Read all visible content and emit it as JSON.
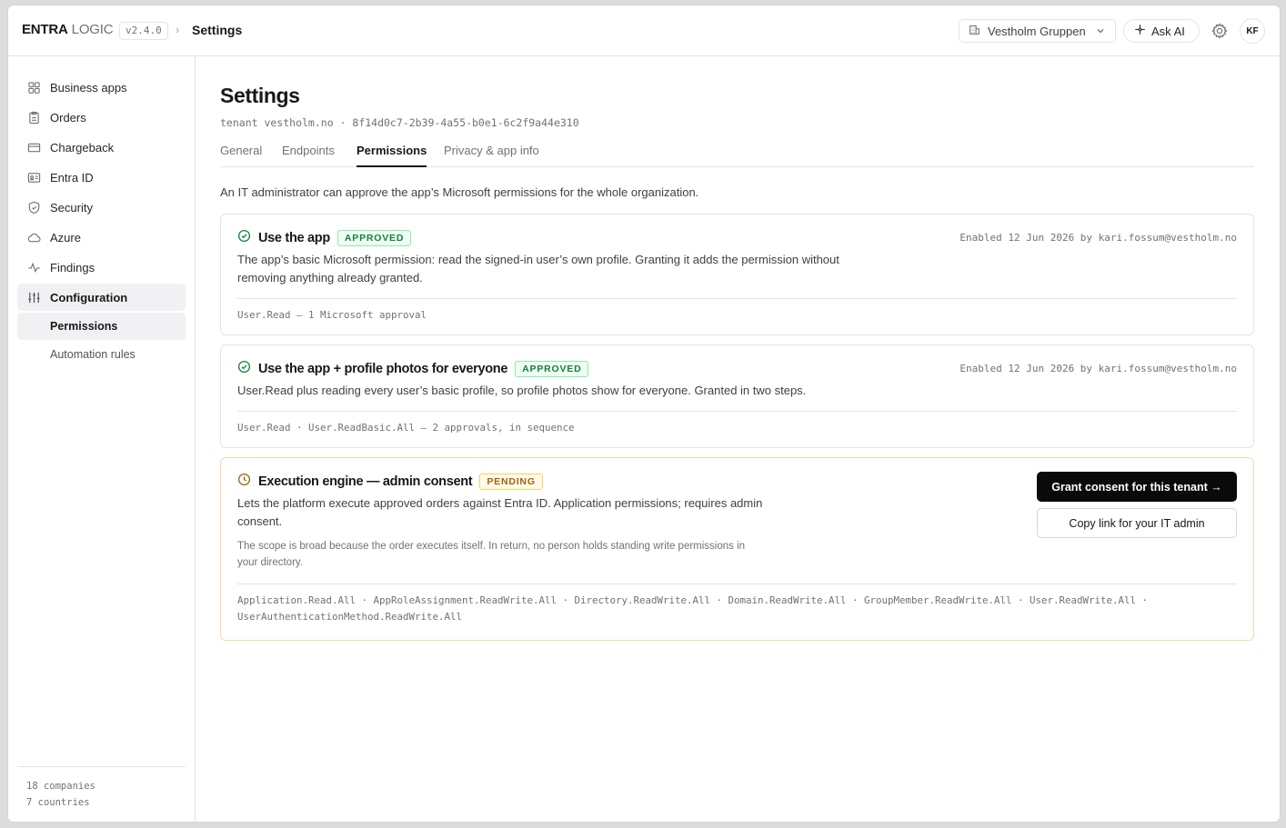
{
  "header": {
    "brand_strong": "ENTRA",
    "brand_light": "LOGIC",
    "version": "v2.4.0",
    "breadcrumb_sep": "›",
    "breadcrumb": "Settings",
    "org_selector": "Vestholm Gruppen",
    "ask_ai": "Ask AI",
    "avatar_initials": "KF"
  },
  "sidebar": {
    "items": [
      {
        "label": "Business apps",
        "icon": "grid-icon"
      },
      {
        "label": "Orders",
        "icon": "clipboard-icon"
      },
      {
        "label": "Chargeback",
        "icon": "credit-card-icon"
      },
      {
        "label": "Entra ID",
        "icon": "id-card-icon"
      },
      {
        "label": "Security",
        "icon": "shield-icon"
      },
      {
        "label": "Azure",
        "icon": "cloud-icon"
      },
      {
        "label": "Findings",
        "icon": "activity-icon"
      },
      {
        "label": "Configuration",
        "icon": "sliders-icon",
        "active": true
      }
    ],
    "subitems": [
      {
        "label": "Permissions",
        "active": true
      },
      {
        "label": "Automation rules"
      }
    ],
    "footer": {
      "companies": "18 companies",
      "countries": "7 countries"
    }
  },
  "main": {
    "title": "Settings",
    "tenant_line": "tenant vestholm.no · 8f14d0c7-2b39-4a55-b0e1-6c2f9a44e310",
    "tabs": [
      {
        "label": "General"
      },
      {
        "label": "Endpoints"
      },
      {
        "label": "Permissions",
        "active": true
      },
      {
        "label": "Privacy & app info"
      }
    ],
    "intro": "An IT administrator can approve the app’s Microsoft permissions for the whole organization.",
    "cards": [
      {
        "title": "Use the app",
        "status": "APPROVED",
        "enabled": "Enabled 12 Jun 2026 by kari.fossum@vestholm.no",
        "desc_1": "The app’s basic Microsoft permission: read the signed-in user’s own profile. Granting it adds the permission without",
        "desc_2": "removing anything already granted.",
        "scopes": "User.Read — 1 Microsoft approval"
      },
      {
        "title": "Use the app + profile photos for everyone",
        "status": "APPROVED",
        "enabled": "Enabled 12 Jun 2026 by kari.fossum@vestholm.no",
        "desc_1": "User.Read plus reading every user’s basic profile, so profile photos show for everyone. Granted in two steps.",
        "scopes": "User.Read · User.ReadBasic.All — 2 approvals, in sequence"
      },
      {
        "title": "Execution engine — admin consent",
        "status": "PENDING",
        "desc_1": "Lets the platform execute approved orders against Entra ID. Application permissions; requires admin",
        "desc_2": "consent.",
        "note_1": "The scope is broad because the order executes itself. In return, no person holds standing write permissions in",
        "note_2": "your directory.",
        "scopes_1": "Application.Read.All · AppRoleAssignment.ReadWrite.All · Directory.ReadWrite.All · Domain.ReadWrite.All · GroupMember.ReadWrite.All · User.ReadWrite.All ·",
        "scopes_2": "UserAuthenticationMethod.ReadWrite.All",
        "primary_btn": "Grant consent for this tenant →",
        "secondary_btn": "Copy link for your IT admin"
      }
    ]
  },
  "colors": {
    "approved": "#15803d",
    "pending": "#a16207",
    "primary_button": "#0a0a0a"
  }
}
